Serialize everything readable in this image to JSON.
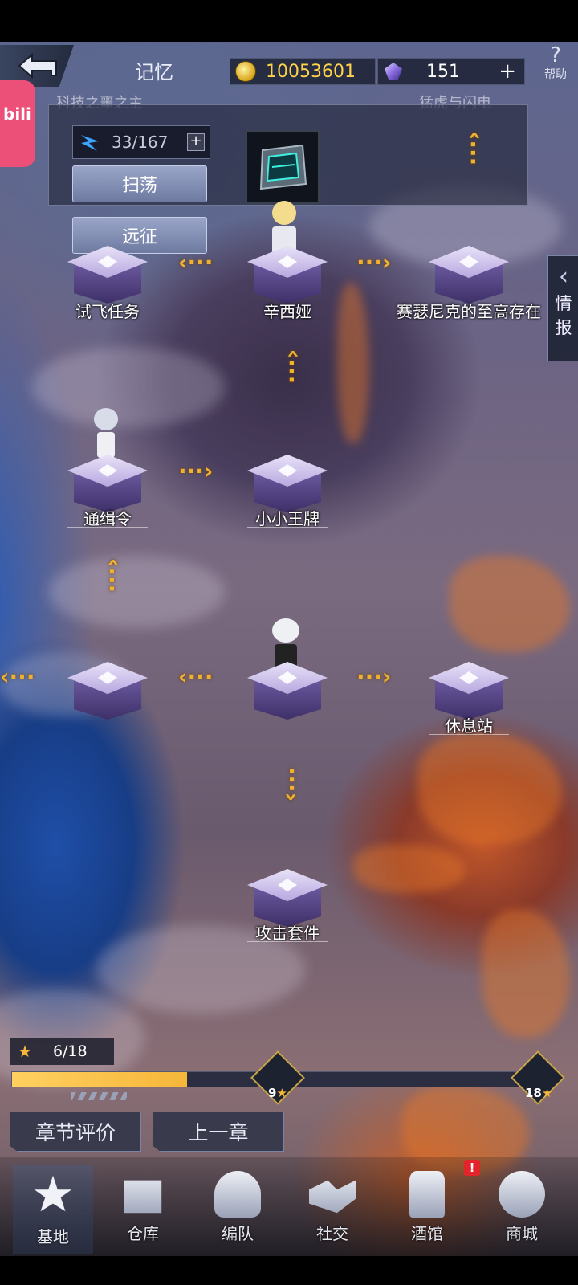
{
  "header": {
    "title": "记忆",
    "gold": "10053601",
    "gems": "151",
    "gem_add": "+",
    "help_label": "帮助",
    "help_symbol": "?"
  },
  "overlay_app": {
    "label": "bili"
  },
  "stage_panel": {
    "faded_left": "科技之噩之主",
    "faded_right": "猛虎与闪电",
    "stamina": "33/167",
    "stamina_add": "+",
    "sweep_label": "扫荡",
    "expedition_label": "远征"
  },
  "side_tab": {
    "label_1": "情",
    "label_2": "报"
  },
  "nodes": {
    "n1": "试飞任务",
    "n2": "辛西娅",
    "n3": "赛瑟尼克的至高存在",
    "n4": "通缉令",
    "n5": "小小王牌",
    "n6": "休息站",
    "n7": "攻击套件"
  },
  "chapter": {
    "stars_text": "6/18",
    "progress_fraction": 0.33,
    "reward_1": "9",
    "reward_2": "18",
    "rating_label": "章节评价",
    "prev_label": "上一章"
  },
  "nav": {
    "base": "基地",
    "warehouse": "仓库",
    "team": "编队",
    "social": "社交",
    "tavern": "酒馆",
    "shop": "商城",
    "alert_symbol": "!"
  },
  "colors": {
    "accent": "#f6b73a",
    "gold": "#ffd24a",
    "alert": "#e3242b"
  }
}
